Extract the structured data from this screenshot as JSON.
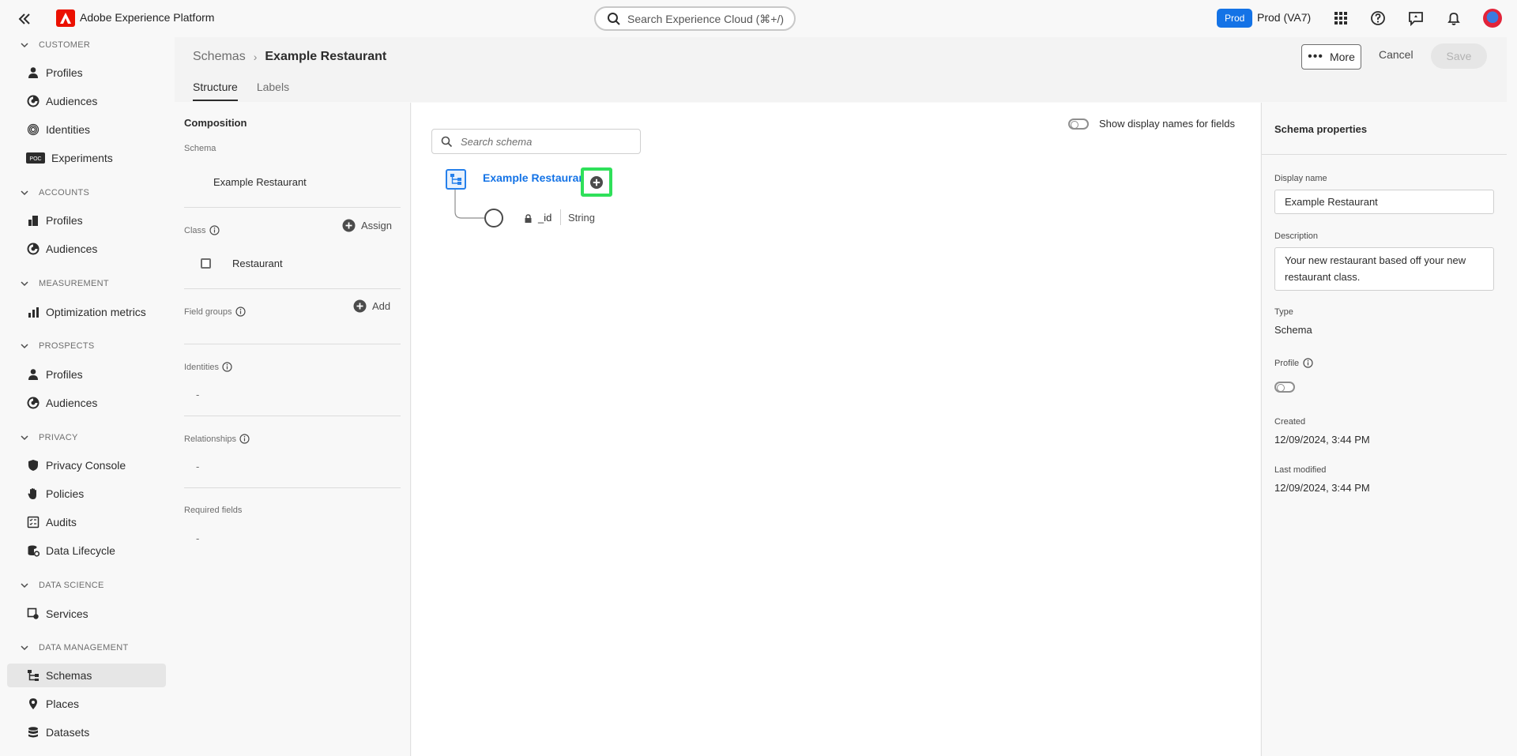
{
  "app": {
    "title": "Adobe Experience Platform",
    "search_placeholder": "Search Experience Cloud (⌘+/)",
    "env_badge": "Prod",
    "env_label": "Prod (VA7)"
  },
  "sidebar": {
    "sections": [
      {
        "label": "CUSTOMER"
      },
      {
        "label": "ACCOUNTS"
      },
      {
        "label": "MEASUREMENT"
      },
      {
        "label": "PROSPECTS"
      },
      {
        "label": "PRIVACY"
      },
      {
        "label": "DATA SCIENCE"
      },
      {
        "label": "DATA MANAGEMENT"
      }
    ],
    "items": [
      {
        "label": "Profiles",
        "icon": "person-icon"
      },
      {
        "label": "Audiences",
        "icon": "audiences-icon"
      },
      {
        "label": "Identities",
        "icon": "fingerprint-icon"
      },
      {
        "label": "Experiments",
        "icon": "poc-badge-icon",
        "badge": "POC"
      },
      {
        "label": "Profiles",
        "icon": "building-icon"
      },
      {
        "label": "Audiences",
        "icon": "audiences-icon"
      },
      {
        "label": "Optimization metrics",
        "icon": "chart-icon"
      },
      {
        "label": "Profiles",
        "icon": "person-icon"
      },
      {
        "label": "Audiences",
        "icon": "audiences-icon"
      },
      {
        "label": "Privacy Console",
        "icon": "shield-icon"
      },
      {
        "label": "Policies",
        "icon": "hand-icon"
      },
      {
        "label": "Audits",
        "icon": "checklist-icon"
      },
      {
        "label": "Data Lifecycle",
        "icon": "database-gear-icon"
      },
      {
        "label": "Services",
        "icon": "services-icon"
      },
      {
        "label": "Schemas",
        "icon": "schema-icon",
        "active": true
      },
      {
        "label": "Places",
        "icon": "pin-icon"
      },
      {
        "label": "Datasets",
        "icon": "database-icon"
      }
    ]
  },
  "header": {
    "breadcrumb_parent": "Schemas",
    "breadcrumb_current": "Example Restaurant",
    "tabs": [
      {
        "label": "Structure",
        "active": true
      },
      {
        "label": "Labels",
        "active": false
      }
    ],
    "more_label": "More",
    "cancel_label": "Cancel",
    "save_label": "Save"
  },
  "composition": {
    "title": "Composition",
    "schema_label": "Schema",
    "schema_value": "Example Restaurant",
    "class_label": "Class",
    "assign_label": "Assign",
    "class_value": "Restaurant",
    "field_groups_label": "Field groups",
    "add_label": "Add",
    "identities_label": "Identities",
    "identities_value": "-",
    "relationships_label": "Relationships",
    "relationships_value": "-",
    "required_label": "Required fields",
    "required_value": "-"
  },
  "canvas": {
    "search_placeholder": "Search schema",
    "toggle_label": "Show display names for fields",
    "root_name": "Example Restaurant",
    "fields": [
      {
        "name": "_id",
        "type": "String",
        "locked": true
      }
    ]
  },
  "properties": {
    "title": "Schema properties",
    "display_name_label": "Display name",
    "display_name_value": "Example Restaurant",
    "description_label": "Description",
    "description_value": "Your new restaurant based off your new restaurant class.",
    "type_label": "Type",
    "type_value": "Schema",
    "profile_label": "Profile",
    "created_label": "Created",
    "created_value": "12/09/2024, 3:44 PM",
    "modified_label": "Last modified",
    "modified_value": "12/09/2024, 3:44 PM"
  },
  "colors": {
    "accent": "#1473e6",
    "highlight": "#2fe05a",
    "logo": "#eb1000"
  }
}
